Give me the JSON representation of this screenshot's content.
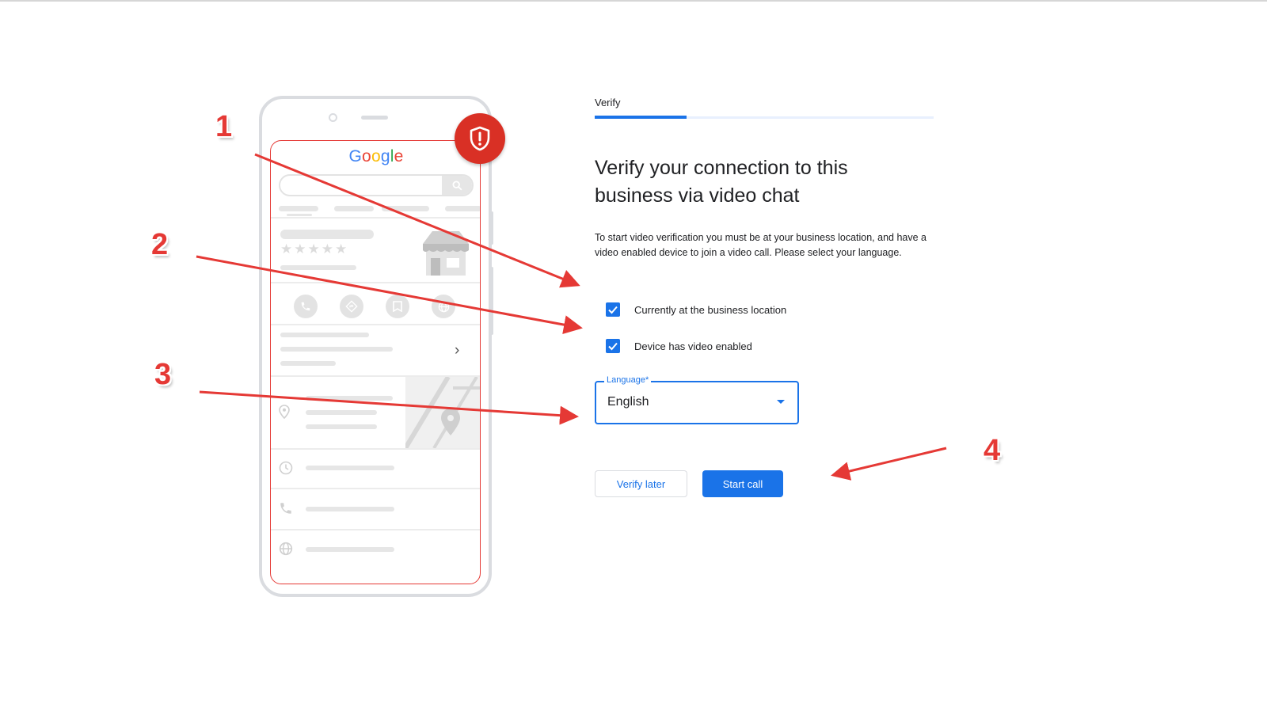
{
  "illustration": {
    "logo_text": "Google",
    "shield_icon": "shield-alert-icon",
    "logo_colors": [
      "#4285F4",
      "#EA4335",
      "#FBBC05",
      "#4285F4",
      "#34A853",
      "#EA4335"
    ]
  },
  "verify": {
    "step_label": "Verify",
    "progress": 0.27,
    "title": "Verify your connection to this business via video chat",
    "description": "To start video verification you must be at your business location, and have a video enabled device to join a video call. Please select your language.",
    "checkboxes": [
      {
        "label": "Currently at the business location",
        "checked": true
      },
      {
        "label": "Device has video enabled",
        "checked": true
      }
    ],
    "language": {
      "label": "Language*",
      "value": "English"
    },
    "buttons": {
      "verify_later": "Verify later",
      "start_call": "Start call"
    }
  },
  "annotations": {
    "labels": [
      "1",
      "2",
      "3",
      "4"
    ],
    "color": "#e53935"
  },
  "colors": {
    "accent": "#1a73e8",
    "shield": "#d93025",
    "annotation": "#e53935"
  }
}
